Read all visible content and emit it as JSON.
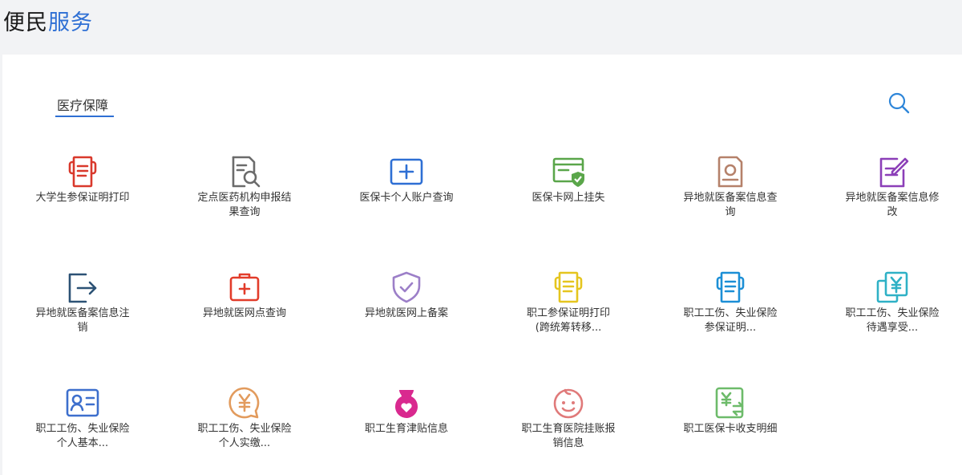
{
  "header": {
    "title_part1": "便民",
    "title_part2": "服务"
  },
  "tab": {
    "label": "医疗保障"
  },
  "items": [
    {
      "label": "大学生参保证明打印",
      "icon": "print-doc-icon",
      "color": "#d9392c"
    },
    {
      "label": "定点医药机构申报结果查询",
      "icon": "doc-search-icon",
      "color": "#6b6b6b"
    },
    {
      "label": "医保卡个人账户查询",
      "icon": "card-plus-icon",
      "color": "#2e6fd4"
    },
    {
      "label": "医保卡网上挂失",
      "icon": "browser-shield-icon",
      "color": "#5aa64a"
    },
    {
      "label": "异地就医备案信息查询",
      "icon": "record-search-icon",
      "color": "#b5816a"
    },
    {
      "label": "异地就医备案信息修改",
      "icon": "edit-doc-icon",
      "color": "#8c3fb8"
    },
    {
      "label": "异地就医备案信息注销",
      "icon": "exit-icon",
      "color": "#2c5275"
    },
    {
      "label": "异地就医网点查询",
      "icon": "medkit-icon",
      "color": "#e23c2a"
    },
    {
      "label": "异地就医网上备案",
      "icon": "shield-check-icon",
      "color": "#9c7fc8"
    },
    {
      "label": "职工参保证明打印(跨统筹转移...",
      "icon": "print-doc-icon",
      "color": "#e5c51f"
    },
    {
      "label": "职工工伤、失业保险参保证明...",
      "icon": "print-doc-icon",
      "color": "#1c8fd6"
    },
    {
      "label": "职工工伤、失业保险待遇享受...",
      "icon": "yuan-card-icon",
      "color": "#2fb1c6"
    },
    {
      "label": "职工工伤、失业保险个人基本...",
      "icon": "id-card-icon",
      "color": "#3d6fcd"
    },
    {
      "label": "职工工伤、失业保险个人实缴...",
      "icon": "yuan-bubble-icon",
      "color": "#e29b5d"
    },
    {
      "label": "职工生育津贴信息",
      "icon": "maternity-icon",
      "color": "#d9298f"
    },
    {
      "label": "职工生育医院挂账报销信息",
      "icon": "baby-face-icon",
      "color": "#e07a7a"
    },
    {
      "label": "职工医保卡收支明细",
      "icon": "yuan-transfer-icon",
      "color": "#6dbb6a"
    }
  ]
}
